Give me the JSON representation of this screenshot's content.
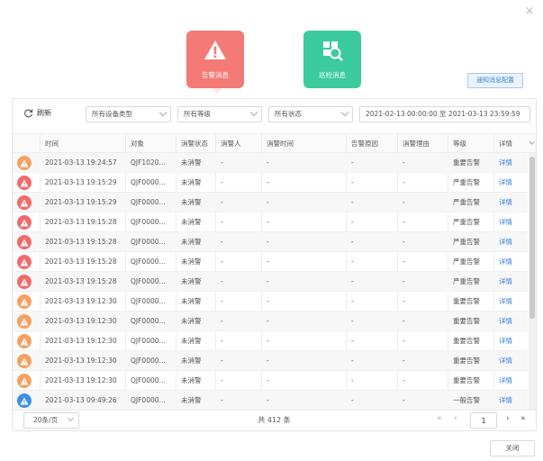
{
  "dialog": {
    "close_glyph": "×",
    "close_button": "关闭"
  },
  "tabs": [
    {
      "label": "告警消息",
      "icon": "warning-triangle-icon",
      "color": "#f37a77"
    },
    {
      "label": "巡检消息",
      "icon": "inspection-search-icon",
      "color": "#3bcb9c"
    }
  ],
  "notify_config": "通知消息配置",
  "toolbar": {
    "refresh": "刷新",
    "device_type": "所有设备类型",
    "level": "所有等级",
    "status": "所有状态",
    "date_range": "2021-02-13 00:00:00 至 2021-03-13 23:59:59"
  },
  "columns": [
    "时间",
    "对象",
    "消警状态",
    "消警人",
    "消警时间",
    "告警原因",
    "消警理由",
    "等级",
    "详情"
  ],
  "level_colors": {
    "严重告警": "#ef6b6b",
    "重要告警": "#f3a162",
    "一般告警": "#3d8fe6"
  },
  "rows": [
    {
      "time": "2021-03-13 19:24:57",
      "object": "QJF1020...",
      "status": "未消警",
      "person": "-",
      "clear_time": "-",
      "reason": "-",
      "clear_reason": "-",
      "level": "重要告警",
      "detail": "详情"
    },
    {
      "time": "2021-03-13 19:15:29",
      "object": "QJF0000...",
      "status": "未消警",
      "person": "-",
      "clear_time": "-",
      "reason": "-",
      "clear_reason": "-",
      "level": "严重告警",
      "detail": "详情"
    },
    {
      "time": "2021-03-13 19:15:29",
      "object": "QJF0000...",
      "status": "未消警",
      "person": "-",
      "clear_time": "-",
      "reason": "-",
      "clear_reason": "-",
      "level": "严重告警",
      "detail": "详情"
    },
    {
      "time": "2021-03-13 19:15:28",
      "object": "QJF0000...",
      "status": "未消警",
      "person": "-",
      "clear_time": "-",
      "reason": "-",
      "clear_reason": "-",
      "level": "严重告警",
      "detail": "详情"
    },
    {
      "time": "2021-03-13 19:15:28",
      "object": "QJF0000...",
      "status": "未消警",
      "person": "-",
      "clear_time": "-",
      "reason": "-",
      "clear_reason": "-",
      "level": "严重告警",
      "detail": "详情"
    },
    {
      "time": "2021-03-13 19:15:28",
      "object": "QJF0000...",
      "status": "未消警",
      "person": "-",
      "clear_time": "-",
      "reason": "-",
      "clear_reason": "-",
      "level": "严重告警",
      "detail": "详情"
    },
    {
      "time": "2021-03-13 19:15:28",
      "object": "QJF0000...",
      "status": "未消警",
      "person": "-",
      "clear_time": "-",
      "reason": "-",
      "clear_reason": "-",
      "level": "严重告警",
      "detail": "详情"
    },
    {
      "time": "2021-03-13 19:12:30",
      "object": "QJF0000...",
      "status": "未消警",
      "person": "-",
      "clear_time": "-",
      "reason": "-",
      "clear_reason": "-",
      "level": "重要告警",
      "detail": "详情"
    },
    {
      "time": "2021-03-13 19:12:30",
      "object": "QJF0000...",
      "status": "未消警",
      "person": "-",
      "clear_time": "-",
      "reason": "-",
      "clear_reason": "-",
      "level": "重要告警",
      "detail": "详情"
    },
    {
      "time": "2021-03-13 19:12:30",
      "object": "QJF0000...",
      "status": "未消警",
      "person": "-",
      "clear_time": "-",
      "reason": "-",
      "clear_reason": "-",
      "level": "重要告警",
      "detail": "详情"
    },
    {
      "time": "2021-03-13 19:12:30",
      "object": "QJF0000...",
      "status": "未消警",
      "person": "-",
      "clear_time": "-",
      "reason": "-",
      "clear_reason": "-",
      "level": "重要告警",
      "detail": "详情"
    },
    {
      "time": "2021-03-13 19:12:30",
      "object": "QJF0000...",
      "status": "未消警",
      "person": "-",
      "clear_time": "-",
      "reason": "-",
      "clear_reason": "-",
      "level": "重要告警",
      "detail": "详情"
    },
    {
      "time": "2021-03-13 09:49:26",
      "object": "QJF0000...",
      "status": "未消警",
      "person": "-",
      "clear_time": "-",
      "reason": "-",
      "clear_reason": "-",
      "level": "一般告警",
      "detail": "详情"
    }
  ],
  "pagination": {
    "page_size": "20条/页",
    "total": "共 412 条",
    "current_page": "1",
    "first": "«",
    "prev": "‹",
    "next": "›",
    "last": "»"
  }
}
